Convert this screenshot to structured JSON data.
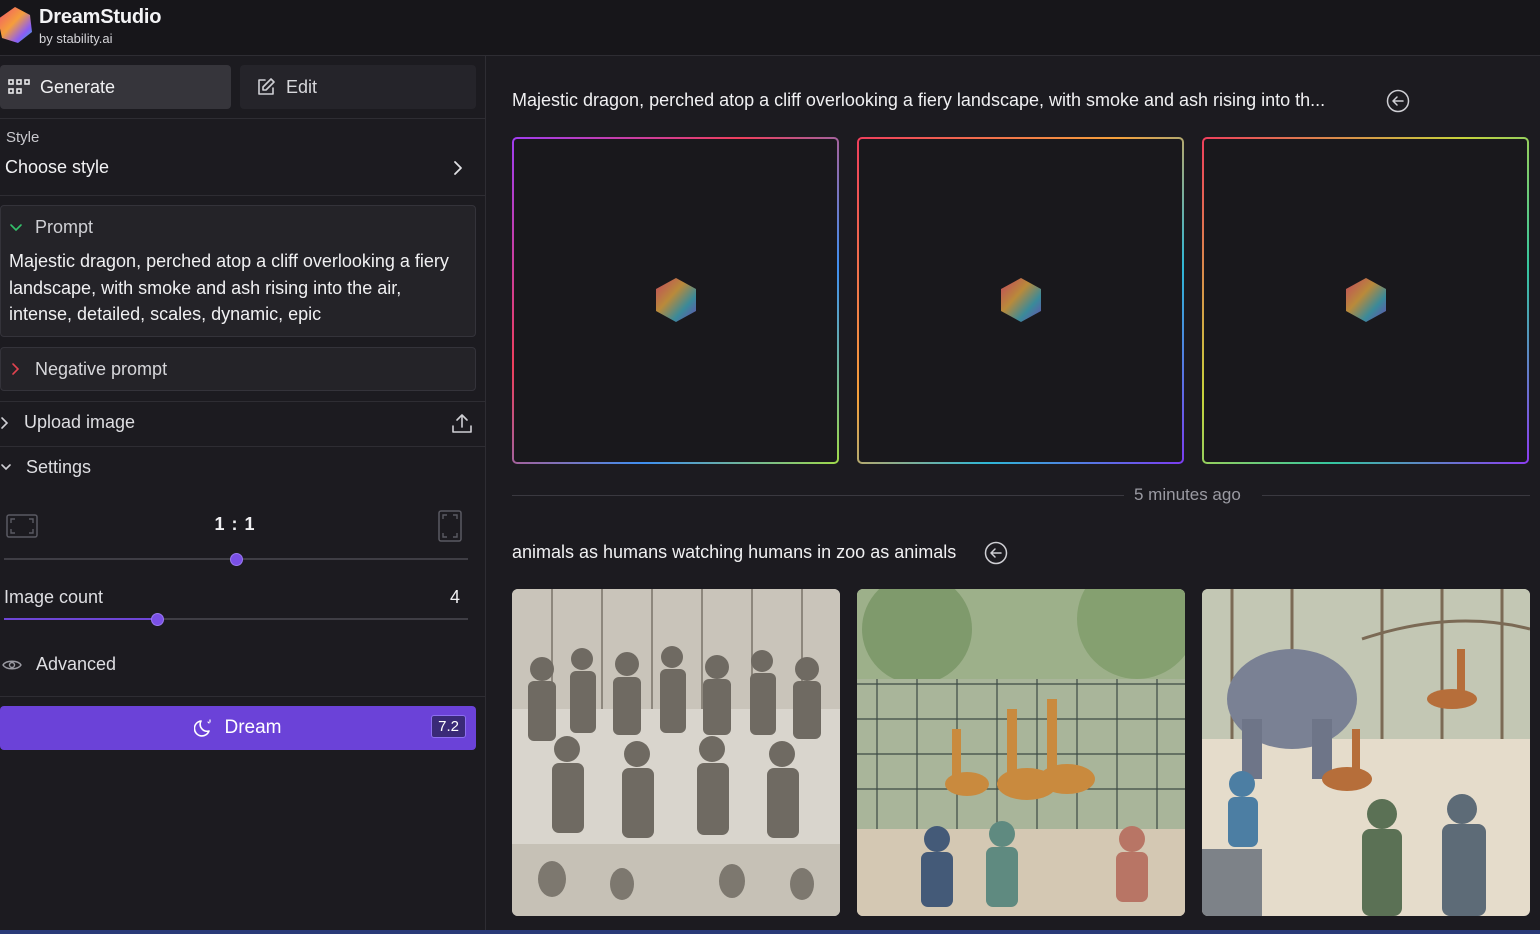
{
  "brand": {
    "name": "DreamStudio",
    "sub": "by stability.ai"
  },
  "sidebar": {
    "modes": [
      {
        "label": "Generate",
        "icon": "grid-icon",
        "active": true
      },
      {
        "label": "Edit",
        "icon": "edit-icon",
        "active": false
      }
    ],
    "style": {
      "label": "Style",
      "value": "Choose style"
    },
    "prompt": {
      "label": "Prompt",
      "text": "Majestic dragon, perched atop a cliff overlooking a fiery landscape, with smoke and ash rising into the air, intense, detailed, scales, dynamic, epic"
    },
    "negative_prompt": {
      "label": "Negative prompt"
    },
    "upload": {
      "label": "Upload image"
    },
    "settings": {
      "label": "Settings",
      "aspect_ratio": "1 : 1",
      "aspect_slider_fraction": 0.5,
      "image_count_label": "Image count",
      "image_count": "4",
      "image_count_fraction": 0.33
    },
    "advanced": {
      "label": "Advanced"
    },
    "dream": {
      "label": "Dream",
      "cost": "7.2"
    }
  },
  "main": {
    "generations": [
      {
        "prompt": "Majestic dragon, perched atop a cliff overlooking a fiery landscape, with smoke and ash rising into th...",
        "status": "generating",
        "count": 3
      },
      {
        "prompt": "animals as humans watching humans in zoo as animals",
        "time": "5 minutes ago",
        "images": [
          "sketch-crowd-image",
          "zoo-giraffes-image",
          "zoo-elephant-image"
        ]
      }
    ]
  },
  "colors": {
    "accent": "#6b42d8",
    "background": "#1c1b20",
    "panel": "#242328"
  }
}
